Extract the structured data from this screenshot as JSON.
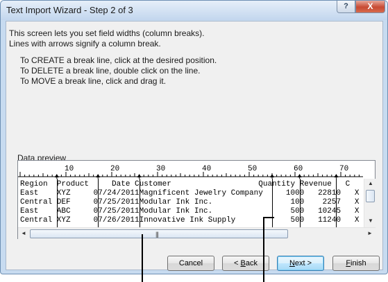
{
  "window": {
    "title": "Text Import Wizard - Step 2 of 3",
    "help_glyph": "?",
    "close_glyph": "X"
  },
  "instructions": {
    "line1": "This screen lets you set field widths (column breaks).",
    "line2": "Lines with arrows signify a column break.",
    "create": "To CREATE a break line, click at the desired position.",
    "delete": "To DELETE a break line, double click on the line.",
    "move": "To MOVE a break line, click and drag it."
  },
  "preview": {
    "label_prefix": "Data ",
    "label_access": "p",
    "label_rest": "review",
    "ruler_labels": [
      "10",
      "20",
      "30",
      "40",
      "50",
      "60",
      "70"
    ],
    "column_breaks": [
      8,
      17,
      26,
      55,
      61,
      69
    ],
    "rows": [
      "Region  Product     Date Customer                   Quantity Revenue   C",
      "East    XYZ     07/24/2011Magnificent Jewelry Company     1000   22810   X",
      "Central DEF     07/25/2011Modular Ink Inc.                 100    2257   X",
      "East    ABC     07/25/2011Modular Ink Inc.                 500   10245   X",
      "Central XYZ     07/26/2011Innovative Ink Supply            500   11240   X"
    ],
    "scroll_grip": "|||"
  },
  "buttons": {
    "cancel": "Cancel",
    "back_prefix": "< ",
    "back_access": "B",
    "back_rest": "ack",
    "next_access": "N",
    "next_rest": "ext >",
    "finish_access": "F",
    "finish_rest": "inish"
  },
  "icons": {
    "scroll_up": "▲",
    "scroll_down": "▼",
    "scroll_left": "◄",
    "scroll_right": "►"
  }
}
